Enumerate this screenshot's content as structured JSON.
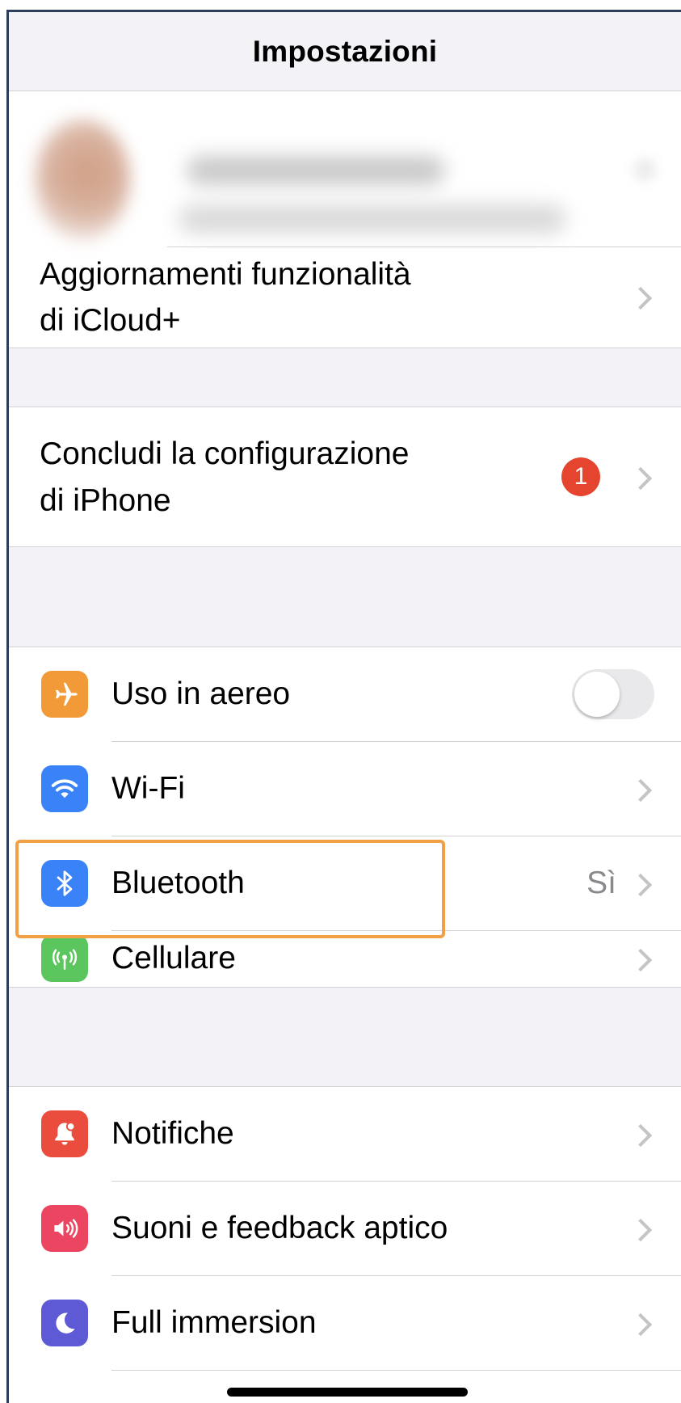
{
  "header": {
    "title": "Impostazioni"
  },
  "profile": {
    "icloud_row": {
      "line1": "Aggiornamenti funzionalità",
      "line2": "di iCloud+"
    }
  },
  "setup": {
    "line1": "Concludi la configurazione",
    "line2": "di iPhone",
    "badge": "1"
  },
  "connectivity": [
    {
      "label": "Uso in aereo",
      "icon": "airplane-icon",
      "color": "#f19a37",
      "toggle_on": false
    },
    {
      "label": "Wi-Fi",
      "icon": "wifi-icon",
      "color": "#3a82f7"
    },
    {
      "label": "Bluetooth",
      "icon": "bluetooth-icon",
      "color": "#3a82f7",
      "value": "Sì"
    },
    {
      "label": "Cellulare",
      "icon": "cellular-icon",
      "color": "#5ac65d"
    }
  ],
  "general": [
    {
      "label": "Notifiche",
      "icon": "notification-bell-icon",
      "color": "#ea4d3d"
    },
    {
      "label": "Suoni e feedback aptico",
      "icon": "speaker-icon",
      "color": "#eb4562"
    },
    {
      "label": "Full immersion",
      "icon": "moon-icon",
      "color": "#5e5ad6"
    }
  ],
  "colors": {
    "highlight": "#f2a045",
    "badge": "#e5452f"
  }
}
